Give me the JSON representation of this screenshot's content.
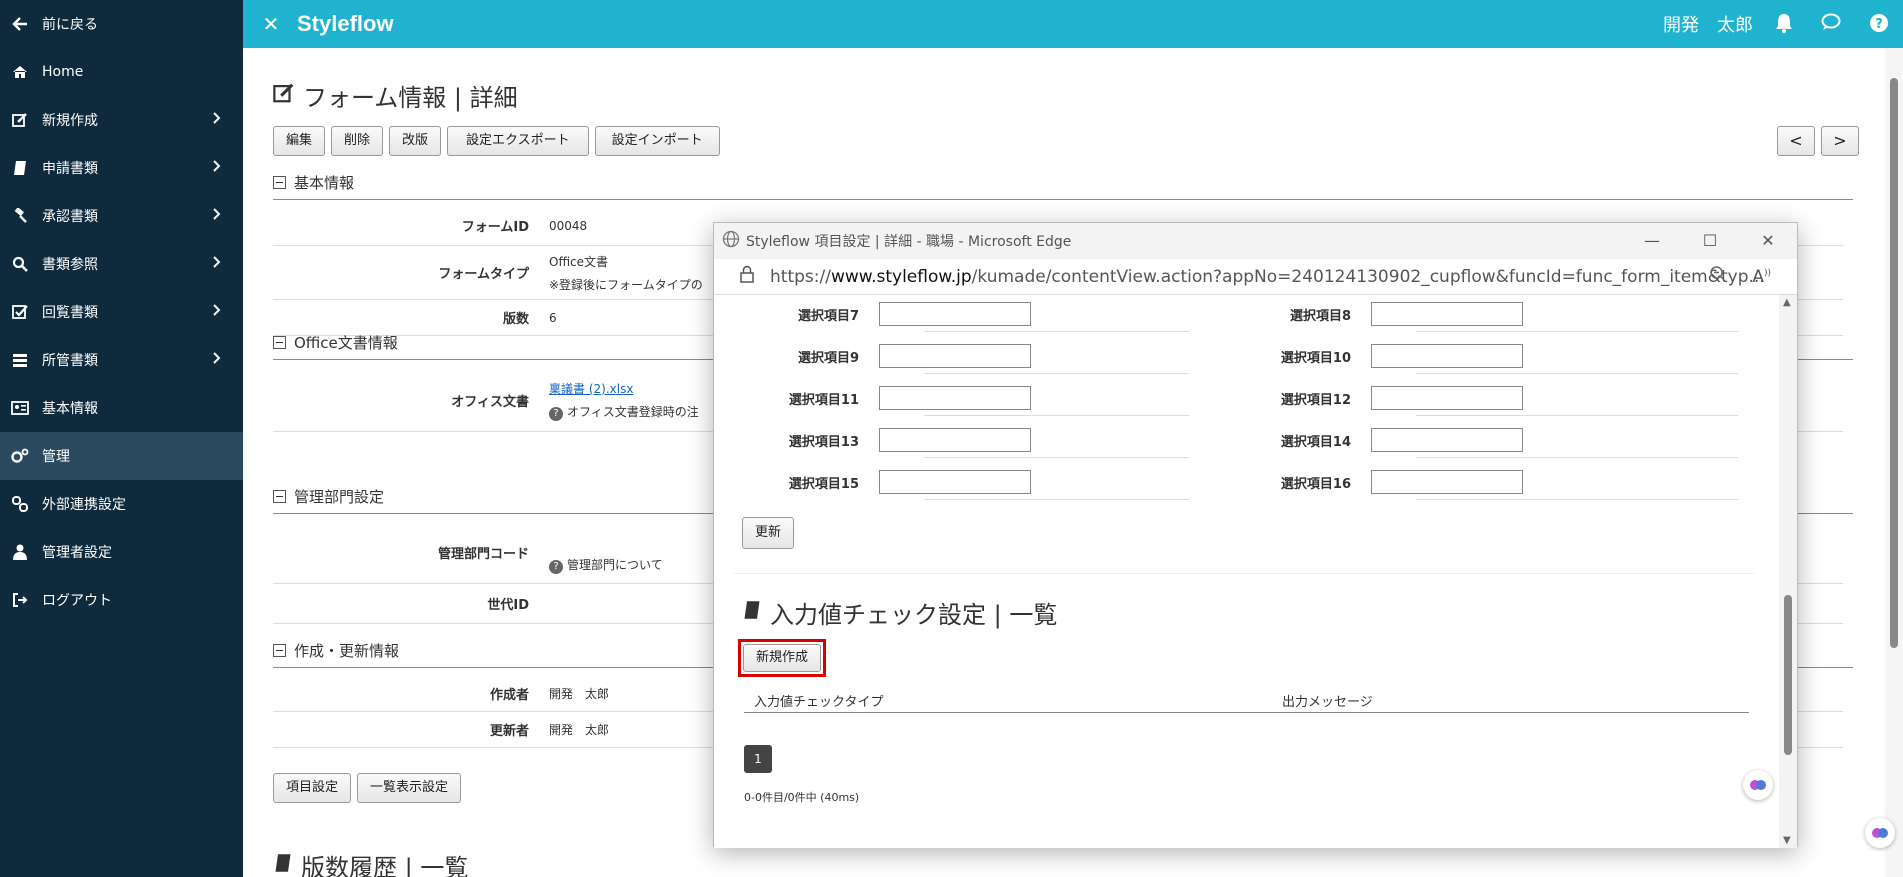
{
  "sidebar": {
    "items": [
      {
        "label": "前に戻る",
        "icon": "arrow-left-icon"
      },
      {
        "label": "Home",
        "icon": "home-icon"
      },
      {
        "label": "新規作成",
        "icon": "edit-icon",
        "chevron": true
      },
      {
        "label": "申請書類",
        "icon": "book-icon",
        "chevron": true
      },
      {
        "label": "承認書類",
        "icon": "gavel-icon",
        "chevron": true
      },
      {
        "label": "書類参照",
        "icon": "search-icon",
        "chevron": true
      },
      {
        "label": "回覧書類",
        "icon": "check-square-icon",
        "chevron": true
      },
      {
        "label": "所管書類",
        "icon": "server-icon",
        "chevron": true
      },
      {
        "label": "基本情報",
        "icon": "id-card-icon"
      },
      {
        "label": "管理",
        "icon": "cogs-icon",
        "active": true
      },
      {
        "label": "外部連携設定",
        "icon": "link-icon"
      },
      {
        "label": "管理者設定",
        "icon": "user-icon"
      },
      {
        "label": "ログアウト",
        "icon": "sign-out-icon"
      }
    ]
  },
  "header": {
    "brand": "Styleflow",
    "user": "開発　太郎",
    "colors": {
      "bar": "#1fb3cf",
      "sidebar": "#0f2a3d"
    }
  },
  "main": {
    "title": "フォーム情報 | 詳細",
    "toolbar": [
      "編集",
      "削除",
      "改版",
      "設定エクスポート",
      "設定インポート"
    ],
    "nav_prev": "<",
    "nav_next": ">",
    "sections": {
      "basic": "基本情報",
      "office": "Office文書情報",
      "dept": "管理部門設定",
      "created": "作成・更新情報"
    },
    "fields": {
      "form_id_label": "フォームID",
      "form_id": "00048",
      "form_type_label": "フォームタイプ",
      "form_type": "Office文書",
      "form_type_note": "※登録後にフォームタイプの",
      "version_label": "版数",
      "version": "6",
      "office_doc_label": "オフィス文書",
      "office_doc_link": "稟議書 (2).xlsx",
      "office_doc_help": "オフィス文書登録時の注",
      "dept_code_label": "管理部門コード",
      "dept_help": "管理部門について",
      "generation_label": "世代ID",
      "creator_label": "作成者",
      "creator": "開発　太郎",
      "updater_label": "更新者",
      "updater": "開発　太郎"
    },
    "bottom_buttons": [
      "項目設定",
      "一覧表示設定"
    ],
    "history_title": "版数履歴 | 一覧"
  },
  "popup": {
    "window_title": "Styleflow 項目設定 | 詳細 - 職場 - Microsoft Edge",
    "url_prefix": "https://",
    "url_domain": "www.styleflow.jp",
    "url_rest": "/kumade/contentView.action?appNo=240124130902_cupflow&funcId=func_form_item&typ...",
    "select_items": [
      {
        "left": "選択項目7",
        "right": "選択項目8"
      },
      {
        "left": "選択項目9",
        "right": "選択項目10"
      },
      {
        "left": "選択項目11",
        "right": "選択項目12"
      },
      {
        "left": "選択項目13",
        "right": "選択項目14"
      },
      {
        "left": "選択項目15",
        "right": "選択項目16"
      }
    ],
    "update_button": "更新",
    "check_title": "入力値チェック設定 | 一覧",
    "new_button": "新規作成",
    "columns": [
      "入力値チェックタイプ",
      "出力メッセージ"
    ],
    "page": "1",
    "result": "0-0件目/0件中 (40ms)"
  }
}
